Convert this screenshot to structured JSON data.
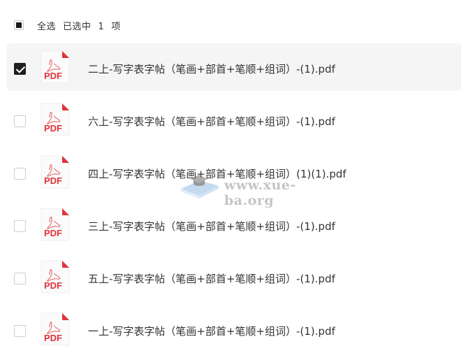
{
  "header": {
    "select_all_label": "全选",
    "selected_prefix": "已选中",
    "selected_count": "1",
    "selected_suffix": "项"
  },
  "files": [
    {
      "name": "二上-写字表字帖（笔画+部首+笔顺+组词）-(1).pdf",
      "checked": true,
      "icon_label": "PDF"
    },
    {
      "name": "六上-写字表字帖（笔画+部首+笔顺+组词）-(1).pdf",
      "checked": false,
      "icon_label": "PDF"
    },
    {
      "name": "四上-写字表字帖（笔画+部首+笔顺+组词）(1)(1).pdf",
      "checked": false,
      "icon_label": "PDF"
    },
    {
      "name": "三上-写字表字帖（笔画+部首+笔顺+组词）-(1).pdf",
      "checked": false,
      "icon_label": "PDF"
    },
    {
      "name": "五上-写字表字帖（笔画+部首+笔顺+组词）-(1).pdf",
      "checked": false,
      "icon_label": "PDF"
    },
    {
      "name": "一上-写字表字帖（笔画+部首+笔顺+组词）-(1).pdf",
      "checked": false,
      "icon_label": "PDF"
    }
  ],
  "watermark": {
    "text": "www.xue-ba.org"
  },
  "colors": {
    "pdf_red": "#e0333a",
    "selected_row_bg": "#f5f5f5",
    "checkbox_checked": "#1f1f1f"
  }
}
